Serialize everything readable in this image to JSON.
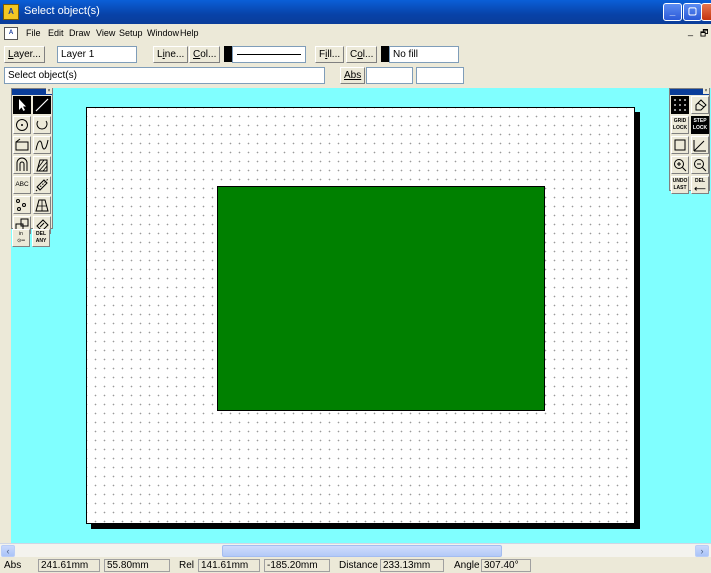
{
  "title": "Select object(s)",
  "menu": [
    "File",
    "Edit",
    "Draw",
    "View",
    "Setup",
    "Window",
    "Help"
  ],
  "toolbar": {
    "layer_button": "Layer...",
    "layer_value": "Layer 1",
    "line_button": "Line...",
    "line_col_button": "Col...",
    "fill_button": "Fill...",
    "fill_col_button": "Col...",
    "fill_value": "No fill",
    "prompt_value": "Select object(s)",
    "abs_button": "Abs",
    "abs_x_value": "",
    "abs_y_value": ""
  },
  "drawing": {
    "shape_fill": "#008000",
    "canvas_background": "#80ffff"
  },
  "left_palette": {
    "text_tool": "ABC",
    "insert_tool": "in",
    "delete_tool": [
      "DEL",
      "ANY"
    ]
  },
  "right_palette": {
    "grid_lock": [
      "GRID",
      "LOCK"
    ],
    "step_lock": [
      "STEP",
      "LOCK"
    ],
    "undo_last": [
      "UNDO",
      "LAST"
    ],
    "del": "DEL"
  },
  "status": {
    "abs_label": "Abs",
    "abs_x": "241.61mm",
    "abs_y": "55.80mm",
    "rel_label": "Rel",
    "rel_x": "141.61mm",
    "rel_y": "-185.20mm",
    "distance_label": "Distance",
    "distance": "233.13mm",
    "angle_label": "Angle",
    "angle": "307.40°"
  }
}
